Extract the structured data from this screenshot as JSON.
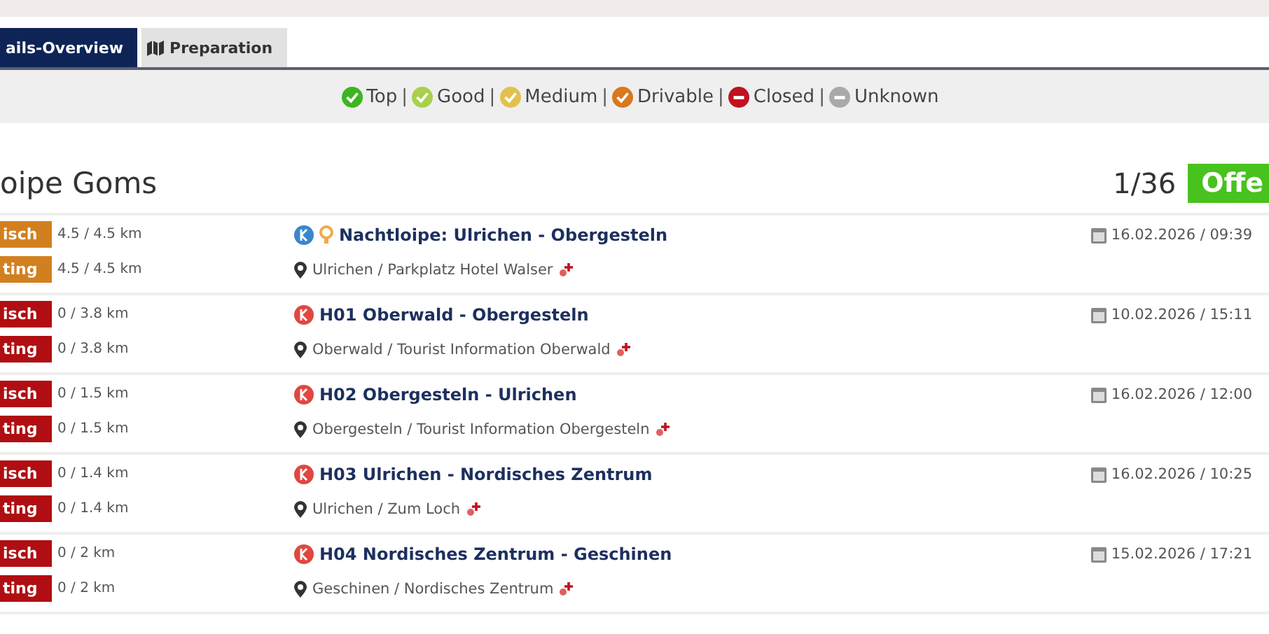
{
  "tabs": [
    {
      "label": "ails-Overview",
      "selected": true,
      "icon": false
    },
    {
      "label": "Preparation",
      "selected": false,
      "icon": true
    }
  ],
  "legend": [
    {
      "label": "Top",
      "kind": "check",
      "color": "#3cb521",
      "separator": "|"
    },
    {
      "label": "Good",
      "kind": "check",
      "color": "#a8d04c",
      "separator": "|"
    },
    {
      "label": "Medium",
      "kind": "check",
      "color": "#e3c04e",
      "separator": "|"
    },
    {
      "label": "Drivable",
      "kind": "check",
      "color": "#d9781c",
      "separator": "|"
    },
    {
      "label": "Closed",
      "kind": "minus",
      "color": "#c0121f",
      "separator": "|"
    },
    {
      "label": "Unknown",
      "kind": "minus",
      "color": "#a9a9a9"
    }
  ],
  "title": "oipe Goms",
  "count": "1/36",
  "status_badge": "Offe",
  "routes": [
    {
      "badges": [
        {
          "label": "isch",
          "color": "#d2801f",
          "distance": "4.5 / 4.5 km"
        },
        {
          "label": "ting",
          "color": "#d2801f",
          "distance": "4.5 / 4.5 km"
        }
      ],
      "color": "#3a86cc",
      "night": true,
      "name": "Nachtloipe: Ulrichen - Obergesteln",
      "location": "Ulrichen / Parkplatz Hotel Walser",
      "date": "16.02.2026 / 09:39"
    },
    {
      "badges": [
        {
          "label": "isch",
          "color": "#b00e12",
          "distance": "0 / 3.8 km"
        },
        {
          "label": "ting",
          "color": "#b00e12",
          "distance": "0 / 3.8 km"
        }
      ],
      "color": "#e0473f",
      "night": false,
      "name": "H01 Oberwald - Obergesteln",
      "location": "Oberwald / Tourist Information Oberwald",
      "date": "10.02.2026 / 15:11"
    },
    {
      "badges": [
        {
          "label": "isch",
          "color": "#b00e12",
          "distance": "0 / 1.5 km"
        },
        {
          "label": "ting",
          "color": "#b00e12",
          "distance": "0 / 1.5 km"
        }
      ],
      "color": "#e0473f",
      "night": false,
      "name": "H02 Obergesteln - Ulrichen",
      "location": "Obergesteln / Tourist Information Obergesteln",
      "date": "16.02.2026 / 12:00"
    },
    {
      "badges": [
        {
          "label": "isch",
          "color": "#b00e12",
          "distance": "0 / 1.4 km"
        },
        {
          "label": "ting",
          "color": "#b00e12",
          "distance": "0 / 1.4 km"
        }
      ],
      "color": "#e0473f",
      "night": false,
      "name": "H03 Ulrichen - Nordisches Zentrum",
      "location": "Ulrichen / Zum Loch",
      "date": "16.02.2026 / 10:25"
    },
    {
      "badges": [
        {
          "label": "isch",
          "color": "#b00e12",
          "distance": "0 / 2 km"
        },
        {
          "label": "ting",
          "color": "#b00e12",
          "distance": "0 / 2 km"
        }
      ],
      "color": "#e0473f",
      "night": false,
      "name": "H04 Nordisches Zentrum - Geschinen",
      "location": "Geschinen / Nordisches Zentrum",
      "date": "15.02.2026 / 17:21"
    }
  ]
}
